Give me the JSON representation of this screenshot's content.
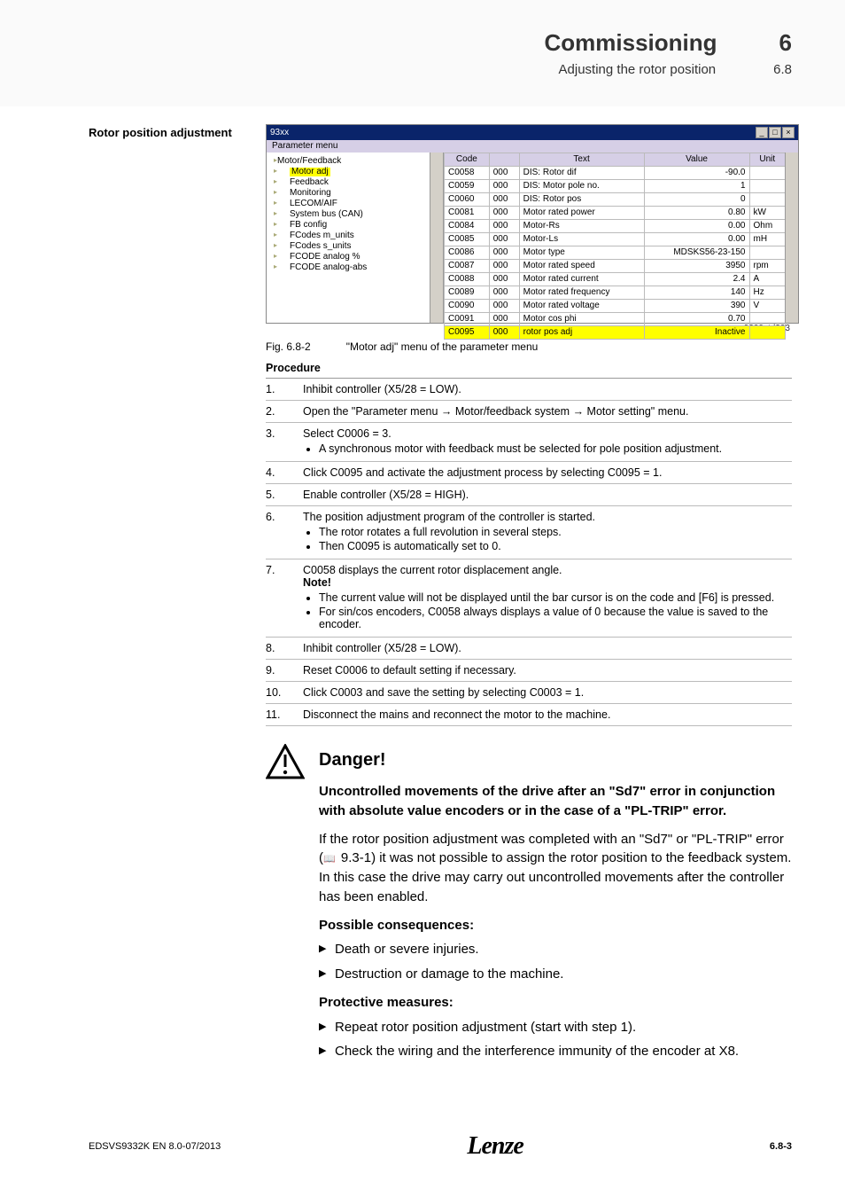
{
  "header": {
    "title": "Commissioning",
    "chapter_num": "6",
    "subtitle": "Adjusting the rotor position",
    "section_num": "6.8"
  },
  "side_label": "Rotor position adjustment",
  "screenshot": {
    "titlebar": "93xx",
    "menubar": "Parameter menu",
    "tree": {
      "root": "Motor/Feedback",
      "items": [
        {
          "label": "Motor adj",
          "hl": true
        },
        {
          "label": "Feedback"
        },
        {
          "label": "Monitoring"
        },
        {
          "label": "LECOM/AIF"
        },
        {
          "label": "System bus (CAN)"
        },
        {
          "label": "FB config"
        },
        {
          "label": "FCodes m_units"
        },
        {
          "label": "FCodes s_units"
        },
        {
          "label": "FCODE analog %"
        },
        {
          "label": "FCODE analog-abs"
        }
      ]
    },
    "columns": [
      "Code",
      "",
      "Text",
      "Value",
      "Unit"
    ],
    "rows": [
      {
        "code": "C0058",
        "sub": "000",
        "text": "DIS: Rotor dif",
        "value": "-90.0",
        "unit": ""
      },
      {
        "code": "C0059",
        "sub": "000",
        "text": "DIS: Motor pole no.",
        "value": "1",
        "unit": ""
      },
      {
        "code": "C0060",
        "sub": "000",
        "text": "DIS: Rotor pos",
        "value": "0",
        "unit": ""
      },
      {
        "code": "C0081",
        "sub": "000",
        "text": "Motor rated power",
        "value": "0.80",
        "unit": "kW"
      },
      {
        "code": "C0084",
        "sub": "000",
        "text": "Motor-Rs",
        "value": "0.00",
        "unit": "Ohm"
      },
      {
        "code": "C0085",
        "sub": "000",
        "text": "Motor-Ls",
        "value": "0.00",
        "unit": "mH"
      },
      {
        "code": "C0086",
        "sub": "000",
        "text": "Motor type",
        "value": "MDSKS56-23-150",
        "unit": ""
      },
      {
        "code": "C0087",
        "sub": "000",
        "text": "Motor rated speed",
        "value": "3950",
        "unit": "rpm"
      },
      {
        "code": "C0088",
        "sub": "000",
        "text": "Motor rated current",
        "value": "2.4",
        "unit": "A"
      },
      {
        "code": "C0089",
        "sub": "000",
        "text": "Motor rated frequency",
        "value": "140",
        "unit": "Hz"
      },
      {
        "code": "C0090",
        "sub": "000",
        "text": "Motor rated voltage",
        "value": "390",
        "unit": "V"
      },
      {
        "code": "C0091",
        "sub": "000",
        "text": "Motor cos phi",
        "value": "0.70",
        "unit": ""
      },
      {
        "code": "C0095",
        "sub": "000",
        "text": "rotor pos adj",
        "value": "Inactive",
        "unit": "",
        "hl": true
      }
    ],
    "img_id": "9300std203"
  },
  "fig_caption": {
    "id": "Fig. 6.8-2",
    "text": "\"Motor adj\" menu of the parameter menu"
  },
  "procedure": {
    "heading": "Procedure",
    "steps": [
      {
        "n": "1.",
        "t": "Inhibit controller (X5/28 = LOW)."
      },
      {
        "n": "2.",
        "t": "Open the \"Parameter menu → Motor/feedback system → Motor setting\" menu."
      },
      {
        "n": "3.",
        "t": "Select C0006 = 3.",
        "bullets": [
          "A synchronous motor with feedback must be selected for pole position adjustment."
        ]
      },
      {
        "n": "4.",
        "t": "Click C0095 and activate the adjustment process by selecting C0095 = 1."
      },
      {
        "n": "5.",
        "t": "Enable controller (X5/28 = HIGH)."
      },
      {
        "n": "6.",
        "t": "The position adjustment program of the controller is started.",
        "bullets": [
          "The rotor rotates a full revolution in several steps.",
          "Then C0095 is automatically set to 0."
        ]
      },
      {
        "n": "7.",
        "t": "C0058 displays the current rotor displacement angle.",
        "note": "Note!",
        "bullets": [
          "The current value will not be displayed until the bar cursor is on the code and [F6] is pressed.",
          "For sin/cos encoders, C0058 always displays a value of 0 because the value is saved to the encoder."
        ]
      },
      {
        "n": "8.",
        "t": "Inhibit controller (X5/28 = LOW)."
      },
      {
        "n": "9.",
        "t": "Reset C0006 to default setting if necessary."
      },
      {
        "n": "10.",
        "t": "Click C0003 and save the setting by selecting C0003 = 1."
      },
      {
        "n": "11.",
        "t": "Disconnect the mains and reconnect the motor to the machine."
      }
    ]
  },
  "danger": {
    "title": "Danger!",
    "lead": "Uncontrolled movements of the drive after an \"Sd7\" error in conjunction with absolute value encoders or in the case of a \"PL-TRIP\" error.",
    "body_pre": "If the rotor position adjustment was completed with an \"Sd7\" or \"PL-TRIP\" error (",
    "body_ref": " 9.3-1",
    "body_post": ") it was not possible to assign the rotor position to the feedback system. In this case the drive may carry out uncontrolled movements after the controller has been enabled.",
    "consequences_h": "Possible consequences:",
    "consequences": [
      "Death or severe injuries.",
      "Destruction or damage to the machine."
    ],
    "measures_h": "Protective measures:",
    "measures": [
      "Repeat rotor position adjustment (start with step 1).",
      "Check the wiring and the interference immunity of the encoder at X8."
    ]
  },
  "footer": {
    "left": "EDSVS9332K EN 8.0-07/2013",
    "center": "Lenze",
    "right": "6.8-3"
  }
}
